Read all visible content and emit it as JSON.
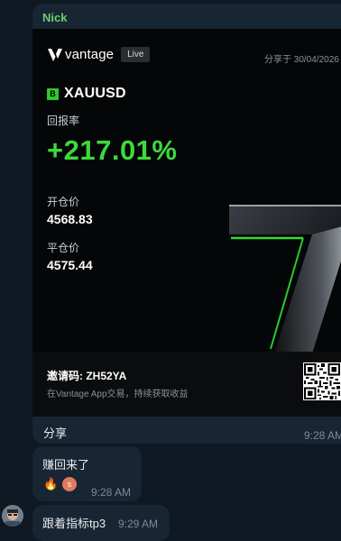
{
  "message": {
    "sender": "Nick",
    "card": {
      "brand": "vantage",
      "badge": "Live",
      "share_date": "分享于 30/04/2026",
      "direction_badge": "B",
      "symbol": "XAUUSD",
      "return_label": "回报率",
      "return_value": "+217.01%",
      "open_label": "开仓价",
      "open_value": "4568.83",
      "close_label": "平仓价",
      "close_value": "4575.44",
      "invite_code": "邀请码: ZH52YA",
      "invite_sub": "在Vantage App交易，持续获取收益",
      "accent_color": "#3dd93d"
    },
    "caption": "分享",
    "time": "9:28 AM"
  },
  "message2": {
    "text": "赚回来了",
    "reaction_emoji": "🔥",
    "reaction_user_initial": "s",
    "time": "9:28 AM"
  },
  "message3": {
    "text": "跟着指标tp3",
    "time": "9:29 AM"
  },
  "icons": {
    "brand_logo": "vantage-v-icon",
    "qr": "qr-code-icon",
    "avatar": "user-avatar"
  }
}
